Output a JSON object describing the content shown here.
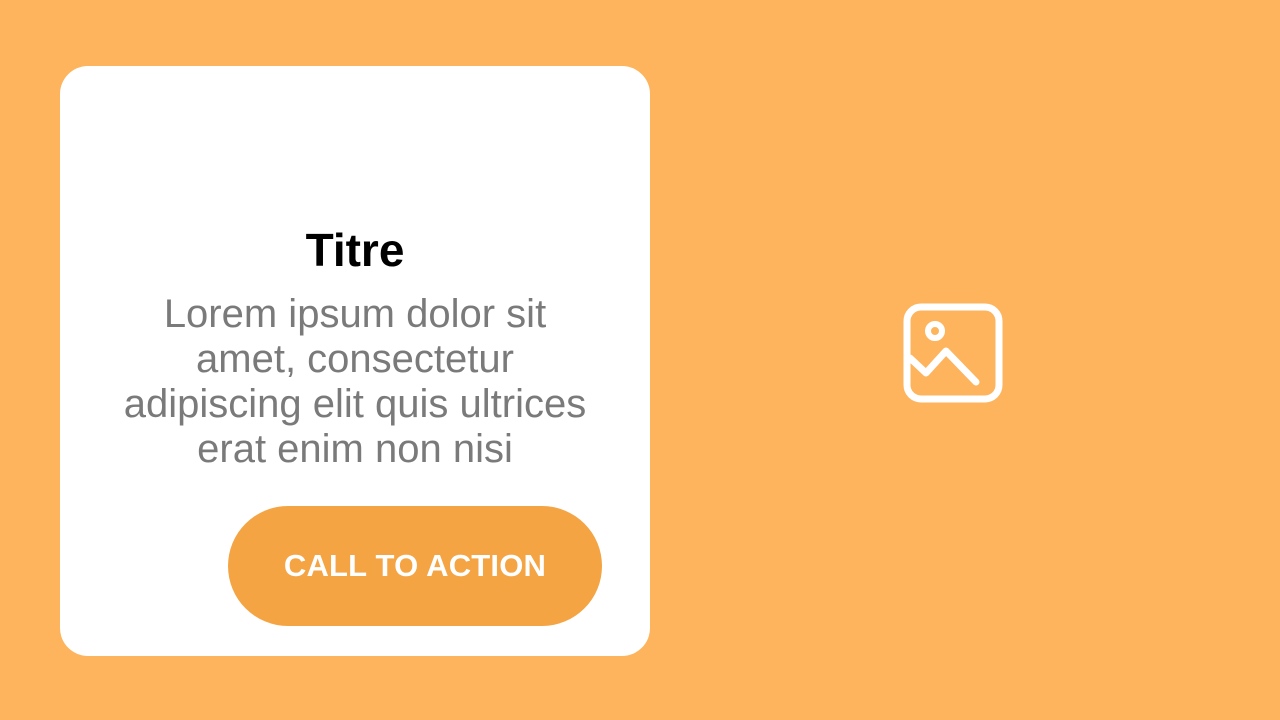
{
  "colors": {
    "background": "#FDB45C",
    "card": "#FFFFFF",
    "title": "#000000",
    "body_text": "#7A7A7A",
    "cta_background": "#F5A443",
    "cta_text": "#FFFFFF",
    "icon": "#FFFFFF"
  },
  "card": {
    "title": "Titre",
    "body_lines": [
      "Lorem ipsum dolor sit",
      "amet, consectetur",
      "adipiscing elit quis ultrices",
      "erat enim non nisi"
    ],
    "cta_label": "CALL TO ACTION"
  },
  "media": {
    "icon": "image-placeholder-icon"
  }
}
